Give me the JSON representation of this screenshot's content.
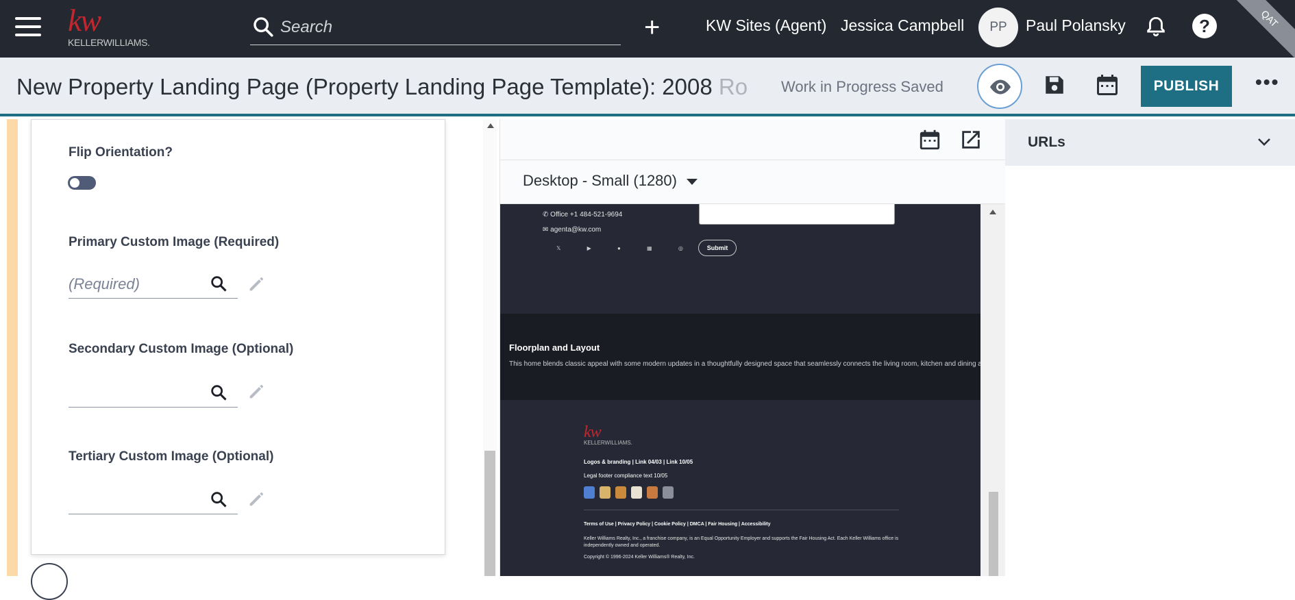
{
  "header": {
    "logo_text": "kw",
    "logo_name": "KELLERWILLIAMS.",
    "search_placeholder": "Search",
    "sites_label": "KW Sites (Agent)",
    "agent_name": "Jessica Campbell",
    "user_initials": "PP",
    "user_name": "Paul Polansky",
    "env_badge": "QAT"
  },
  "subheader": {
    "title": "New Property Landing Page (Property Landing Page Template): 2008 ",
    "title_faded": "Ro",
    "save_status": "Work in Progress Saved",
    "publish_label": "PUBLISH",
    "more_label": "•••"
  },
  "editor": {
    "flip_label": "Flip Orientation?",
    "flip_on": false,
    "primary_label": "Primary Custom Image (Required)",
    "primary_placeholder": "(Required)",
    "secondary_label": "Secondary Custom Image (Optional)",
    "secondary_placeholder": "",
    "tertiary_label": "Tertiary Custom Image (Optional)",
    "tertiary_placeholder": ""
  },
  "preview": {
    "device": "Desktop - Small (1280)",
    "site": {
      "office_phone": "Office +1 484-521-9694",
      "email": "agenta@kw.com",
      "socials": "𝕏 ▶ ● ▦ ◎",
      "submit_label": "Submit",
      "floorplan_title": "Floorplan and Layout",
      "floorplan_text": "This home blends classic appeal with some modern updates in a thoughtfully designed space that seamlessly connects the living room, kitchen and dining area.",
      "footer_logo": "kw",
      "footer_logo_name": "KELLERWILLIAMS.",
      "footer_links": "Logos & branding  |  Link 04/03  |  Link 10/05",
      "footer_legal": "Legal footer compliance text 10/05",
      "footer_policies": "Terms of Use | Privacy Policy | Cookie Policy | DMCA | Fair Housing | Accessibility",
      "footer_disclaimer": "Keller Williams Realty, Inc., a franchise company, is an Equal Opportunity Employer and supports the Fair Housing Act. Each Keller Williams office is independently owned and operated.",
      "footer_copyright": "Copyright © 1996-2024 Keller Williams® Realty, Inc."
    }
  },
  "right_panel": {
    "urls_label": "URLs"
  },
  "colors": {
    "topbar": "#232831",
    "accent": "#1f6f84",
    "kw_red": "#c4262e"
  }
}
